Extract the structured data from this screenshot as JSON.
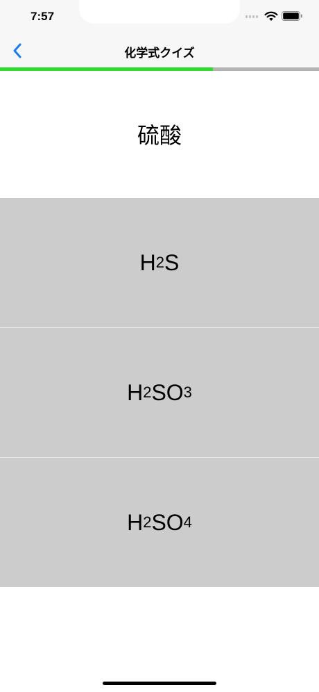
{
  "status_bar": {
    "time": "7:57"
  },
  "nav": {
    "title": "化学式クイズ",
    "back_icon": "chevron-left-icon"
  },
  "progress": {
    "fraction": 0.667
  },
  "question": {
    "text": "硫酸"
  },
  "choices": [
    {
      "parts": [
        {
          "t": "H"
        },
        {
          "t": "2",
          "sub": true
        },
        {
          "t": "S"
        }
      ]
    },
    {
      "parts": [
        {
          "t": "H"
        },
        {
          "t": "2",
          "sub": true
        },
        {
          "t": "SO"
        },
        {
          "t": "3",
          "sub": true
        }
      ]
    },
    {
      "parts": [
        {
          "t": "H"
        },
        {
          "t": "2",
          "sub": true
        },
        {
          "t": "SO"
        },
        {
          "t": "4",
          "sub": true
        }
      ]
    }
  ],
  "colors": {
    "accent": "#1a7cf5",
    "progress_fill": "#2edc2e",
    "progress_track": "#b4b4b4",
    "choice_bg": "#cccccc"
  }
}
